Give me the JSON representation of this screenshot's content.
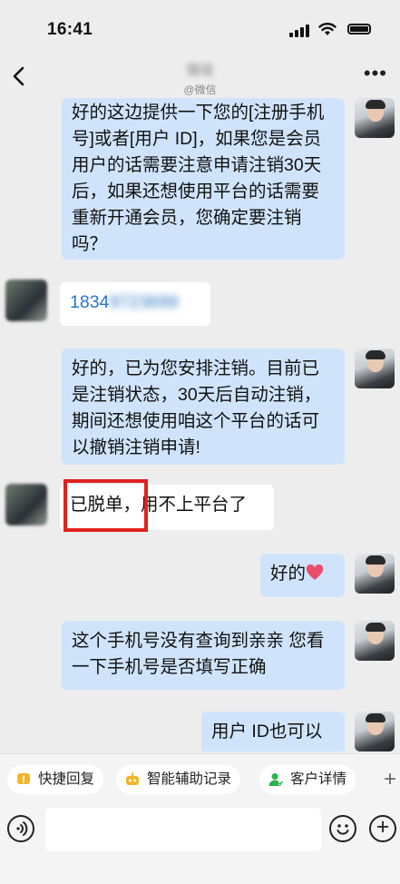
{
  "status_bar": {
    "time": "16:41"
  },
  "nav": {
    "contact_name": "璐瑶",
    "contact_sub": "@微信"
  },
  "messages": [
    {
      "side": "right",
      "text": "好的这边提供一下您的[注册手机号]或者[用户 ID]，如果您是会员用户的话需要注意申请注销30天后，如果还想使用平台的话需要重新开通会员，您确定要注销吗？"
    },
    {
      "side": "left",
      "visible": "1834",
      "blurred": "9723699"
    },
    {
      "side": "right",
      "text": "好的，已为您安排注销。目前已是注销状态，30天后自动注销，期间还想使用咱这个平台的话可以撤销注销申请!"
    },
    {
      "side": "left",
      "text": "已脱单，用不上平台了"
    },
    {
      "side": "right",
      "text": "好的"
    },
    {
      "side": "right",
      "text": "这个手机号没有查询到亲亲 您看一下手机号是否填写正确"
    },
    {
      "side": "right",
      "text": "用户 ID也可以"
    }
  ],
  "quick_bar": {
    "items": [
      "快捷回复",
      "智能辅助记录",
      "客户详情"
    ],
    "plus": "+"
  },
  "input_bar": {
    "placeholder": "",
    "add": "+"
  },
  "colors": {
    "bubble_right": "#cfe4fb",
    "bubble_left": "#ffffff",
    "highlight": "#e0221f",
    "link": "#2a76c4"
  }
}
